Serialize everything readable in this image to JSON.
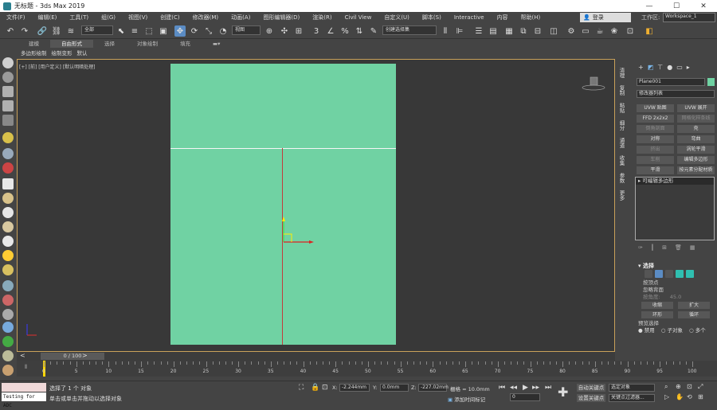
{
  "window": {
    "title": "无标题 - 3ds Max 2019",
    "minimize": "—",
    "maximize": "☐",
    "close": "✕"
  },
  "menu": {
    "items": [
      "文件(F)",
      "编辑(E)",
      "工具(T)",
      "组(G)",
      "视图(V)",
      "创建(C)",
      "修改器(M)",
      "动画(A)",
      "图形编辑器(D)",
      "渲染(R)",
      "Civil View",
      "自定义(U)",
      "脚本(S)",
      "Interactive",
      "内容",
      "帮助(H)"
    ],
    "login": "登录",
    "workspace_label": "工作区:",
    "workspace_value": "Workspace_1"
  },
  "toolbar": {
    "selection_filter": "全部",
    "ref_coord": "视图",
    "named_selection": "创建选择集"
  },
  "ribbon": {
    "tabs": [
      "建模",
      "自由形式",
      "选择",
      "对象绘制",
      "填充"
    ],
    "active_tab": "自由形式",
    "subtabs": [
      "多边形绘制",
      "绘制变形",
      "默认"
    ]
  },
  "viewport": {
    "label": "[+] [前] [用户定义] [默认明暗处理]",
    "plane_color": "#70d2a3"
  },
  "right_tabs": [
    "清理",
    "复制",
    "粘贴",
    "细分",
    "通道",
    "收集",
    "参数",
    "更多"
  ],
  "command_panel": {
    "object_name": "Plane001",
    "modifier_list": "修改器列表",
    "modifier_buttons": [
      {
        "label": "UVW 贴图",
        "dim": false
      },
      {
        "label": "UVW 展开",
        "dim": false
      },
      {
        "label": "FFD 2x2x2",
        "dim": false
      },
      {
        "label": "网格化样条线",
        "dim": true
      },
      {
        "label": "倒角剖面",
        "dim": true
      },
      {
        "label": "壳",
        "dim": false
      },
      {
        "label": "对称",
        "dim": false
      },
      {
        "label": "弯曲",
        "dim": false
      },
      {
        "label": "挤出",
        "dim": true
      },
      {
        "label": "涡轮平滑",
        "dim": false
      },
      {
        "label": "车削",
        "dim": true
      },
      {
        "label": "编辑多边形",
        "dim": false
      },
      {
        "label": "平滑",
        "dim": false
      },
      {
        "label": "按元素分配材质",
        "dim": false
      }
    ],
    "stack_item": "可编辑多边形",
    "selection": {
      "header": "选择",
      "by_vertex": "按顶点",
      "ignore_backfacing": "忽略背面",
      "angle_label": "按角度:",
      "angle_value": "45.0",
      "shrink": "收缩",
      "grow": "扩大",
      "ring": "环形",
      "loop": "循环",
      "preview_label": "预览选择",
      "disabled": "禁用",
      "subobject": "子对象",
      "multi": "多个"
    }
  },
  "timeline": {
    "slider": "0 / 100",
    "ticks": [
      "0",
      "5",
      "10",
      "15",
      "20",
      "25",
      "30",
      "35",
      "40",
      "45",
      "50",
      "55",
      "60",
      "65",
      "70",
      "75",
      "80",
      "85",
      "90",
      "95",
      "100"
    ]
  },
  "status": {
    "script_text": "Testing for ADC",
    "message_selected": "选择了 1 个 对象",
    "message_hint": "单击或单击并拖动以选择对象",
    "x_label": "X:",
    "x_value": "-2.244mm",
    "y_label": "Y:",
    "y_value": "0.0mm",
    "z_label": "Z:",
    "z_value": "-227.02mm",
    "grid": "栅格 = 10.0mm",
    "add_time_tag": "添加时间标记",
    "frame": "0",
    "auto_key": "自动关键点",
    "set_key": "设置关键点",
    "key_target": "选定对象",
    "key_filters": "关键点过滤器..."
  }
}
